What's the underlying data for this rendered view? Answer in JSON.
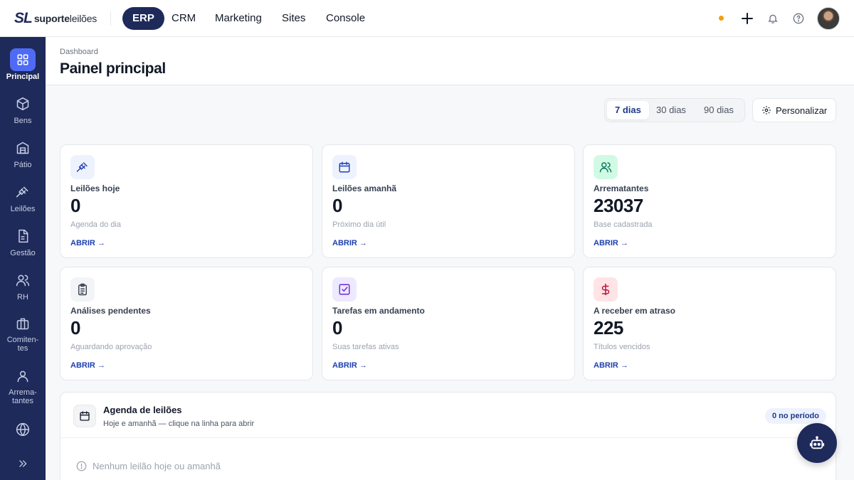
{
  "brand": {
    "mark": "SL",
    "name_bold": "suporte",
    "name_light": "leilões"
  },
  "nav": {
    "tabs": [
      "ERP",
      "CRM",
      "Marketing",
      "Sites",
      "Console"
    ],
    "active": "ERP"
  },
  "sidebar": {
    "items": [
      {
        "label": "Principal",
        "icon": "grid-icon",
        "active": true
      },
      {
        "label": "Bens",
        "icon": "box-icon"
      },
      {
        "label": "Pátio",
        "icon": "warehouse-icon"
      },
      {
        "label": "Leilões",
        "icon": "gavel-icon"
      },
      {
        "label": "Gestão",
        "icon": "document-icon"
      },
      {
        "label": "RH",
        "icon": "users-icon"
      },
      {
        "label": "Comiten-tes",
        "icon": "briefcase-icon"
      },
      {
        "label": "Arrema-tantes",
        "icon": "user-icon"
      },
      {
        "label": "",
        "icon": "globe-icon"
      },
      {
        "label": "",
        "icon": "expand-icon"
      }
    ]
  },
  "header": {
    "breadcrumb": "Dashboard",
    "title": "Painel principal"
  },
  "range": {
    "options": [
      "7 dias",
      "30 dias",
      "90 dias"
    ],
    "active": "7 dias",
    "customize_label": "Personalizar"
  },
  "cards": [
    {
      "title": "Leilões hoje",
      "value": "0",
      "subtitle": "Agenda do dia",
      "link": "ABRIR →",
      "icon": "gavel-icon",
      "icon_color": "#1e40af",
      "icon_bg": "#eef2ff"
    },
    {
      "title": "Leilões amanhã",
      "value": "0",
      "subtitle": "Próximo dia útil",
      "link": "ABRIR →",
      "icon": "calendar-icon",
      "icon_color": "#1e40af",
      "icon_bg": "#eef2ff"
    },
    {
      "title": "Arrematantes",
      "value": "23037",
      "subtitle": "Base cadastrada",
      "link": "ABRIR →",
      "icon": "users-icon",
      "icon_color": "#047857",
      "icon_bg": "#d1fae5"
    },
    {
      "title": "Análises pendentes",
      "value": "0",
      "subtitle": "Aguardando aprovação",
      "link": "ABRIR →",
      "icon": "clipboard-icon",
      "icon_color": "#374151",
      "icon_bg": "#f3f4f6"
    },
    {
      "title": "Tarefas em andamento",
      "value": "0",
      "subtitle": "Suas tarefas ativas",
      "link": "ABRIR →",
      "icon": "checkbox-icon",
      "icon_color": "#6d28d9",
      "icon_bg": "#ede9fe"
    },
    {
      "title": "A receber em atraso",
      "value": "225",
      "subtitle": "Títulos vencidos",
      "link": "ABRIR →",
      "icon": "dollar-icon",
      "icon_color": "#be123c",
      "icon_bg": "#ffe4e6"
    }
  ],
  "agenda": {
    "title": "Agenda de leilões",
    "subtitle": "Hoje e amanhã — clique na linha para abrir",
    "badge": "0 no período",
    "empty": "Nenhum leilão hoje ou amanhã"
  },
  "colors": {
    "primary": "#1e2a5a",
    "accent": "#4f6bf5",
    "link": "#1e40af",
    "status_dot": "#f59e0b"
  }
}
